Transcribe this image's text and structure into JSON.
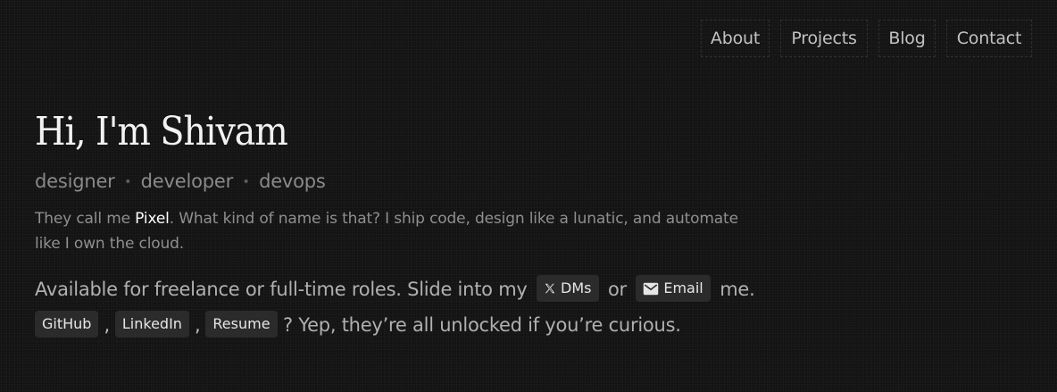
{
  "nav": {
    "items": [
      {
        "label": "About"
      },
      {
        "label": "Projects"
      },
      {
        "label": "Blog"
      },
      {
        "label": "Contact"
      }
    ]
  },
  "hero": {
    "title": "Hi, I'm Shivam",
    "roles": [
      "designer",
      "developer",
      "devops"
    ],
    "roles_separator": "•",
    "bio": {
      "before": "They call me ",
      "nickname": "Pixel",
      "after": ". What kind of name is that? I ship code, design like a lunatic, and automate like I own the cloud."
    },
    "availability": {
      "before": "Available for freelance or full-time roles. Slide into my",
      "dms_label": "DMs",
      "dms_icon": "x-logo-icon",
      "middle": "or",
      "email_label": "Email",
      "email_icon": "mail-icon",
      "after": "me."
    },
    "links": {
      "github": "GitHub",
      "linkedin": "LinkedIn",
      "resume": "Resume",
      "comma": ",",
      "tail": "? Yep, they’re all unlocked if you’re curious."
    }
  },
  "colors": {
    "background": "#141414",
    "heading": "#f2f2f2",
    "muted": "#8a8a8a",
    "chip_bg": "#2b2b2b",
    "highlight": "#ffffff"
  }
}
